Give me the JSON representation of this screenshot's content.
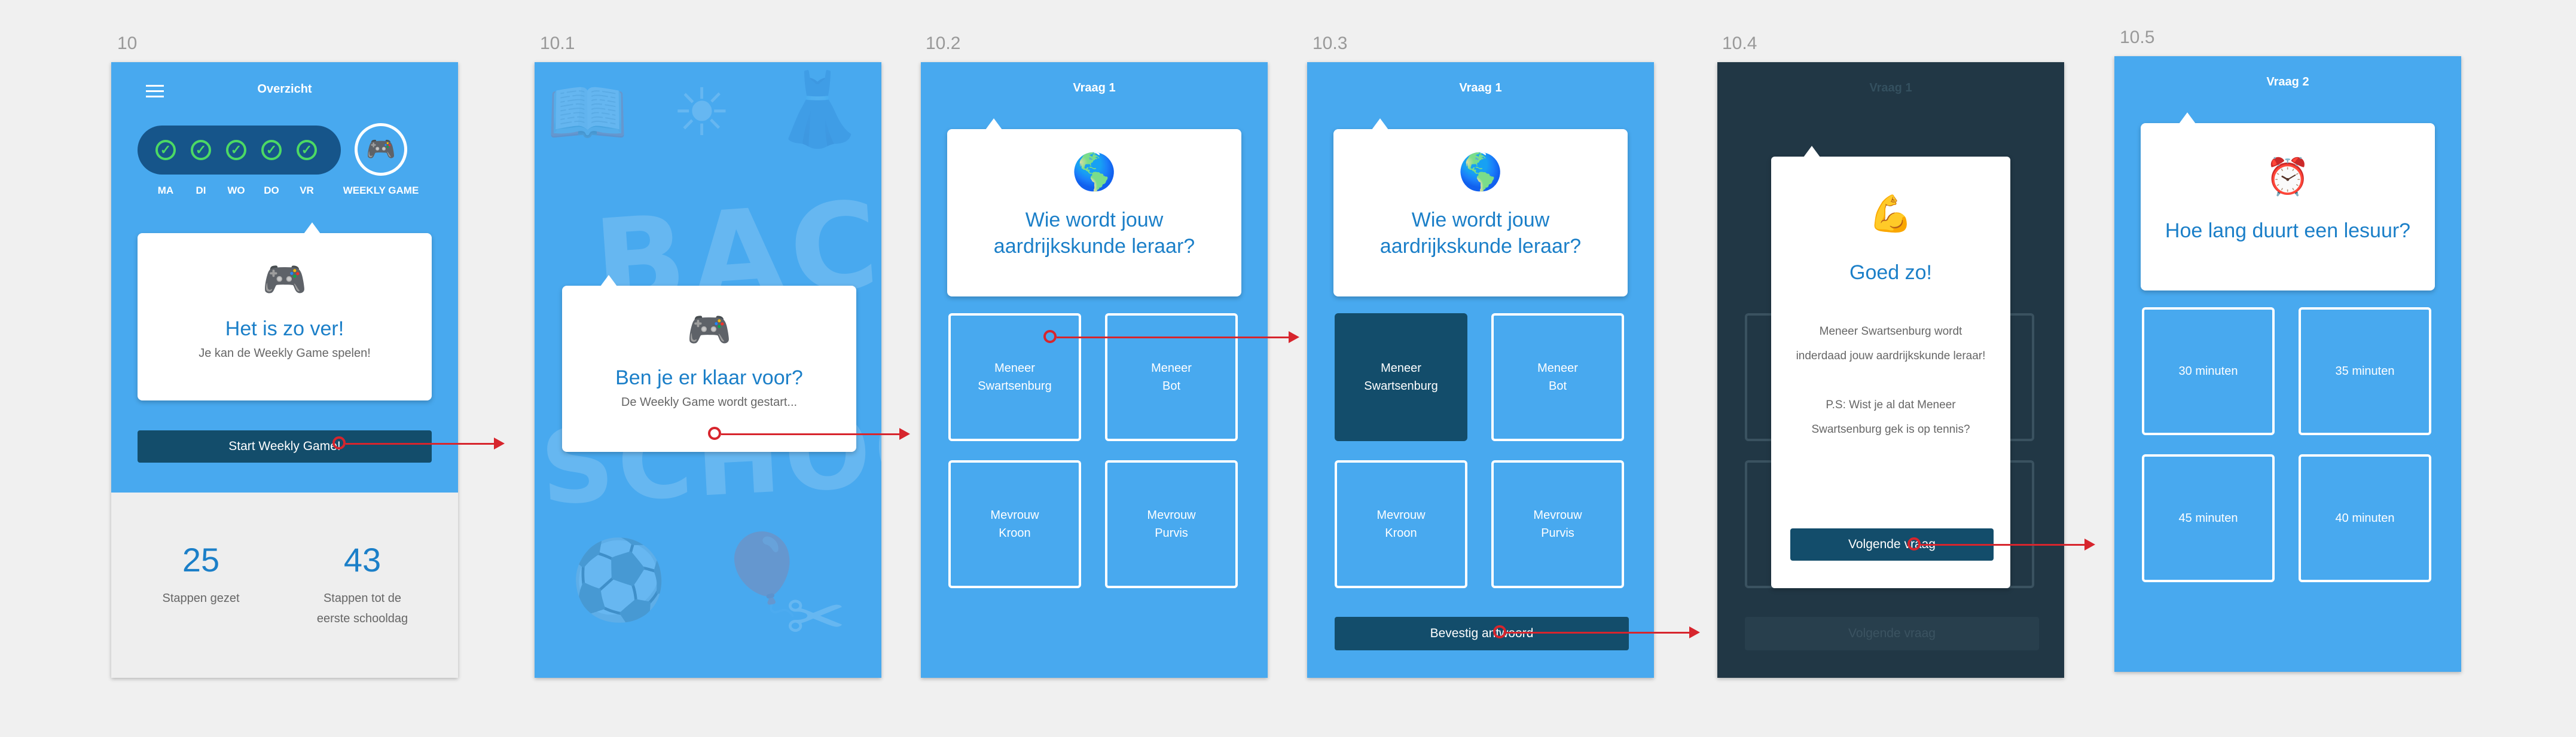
{
  "labels": [
    "10",
    "10.1",
    "10.2",
    "10.3",
    "10.4",
    "10.5"
  ],
  "s10": {
    "title": "Overzicht",
    "days": [
      "MA",
      "DI",
      "WO",
      "DO",
      "VR"
    ],
    "weekly_label": "WEEKLY GAME",
    "emoji": "🎮",
    "heading": "Het is zo ver!",
    "sub": "Je kan de Weekly Game spelen!",
    "button": "Start Weekly Game!",
    "stat1_num": "25",
    "stat1_label": "Stappen gezet",
    "stat2_num": "43",
    "stat2_label": "Stappen tot de\neerste schooldag"
  },
  "s101": {
    "bg_text1": "BACK",
    "bg_text2": "SCHOOL",
    "emoji": "🎮",
    "heading": "Ben je er klaar voor?",
    "sub": "De Weekly Game wordt gestart..."
  },
  "q1": {
    "title": "Vraag 1",
    "emoji": "🌎",
    "question": "Wie wordt jouw\naardrijkskunde leraar?",
    "answers": [
      "Meneer\nSwartsenburg",
      "Meneer\nBot",
      "Mevrouw\nKroon",
      "Mevrouw\nPurvis"
    ],
    "confirm": "Bevestig antwoord"
  },
  "s104": {
    "title": "Vraag 1",
    "emoji": "💪",
    "heading": "Goed zo!",
    "body": "Meneer Swartsenburg wordt inderdaad jouw aardrijkskunde leraar!\n\nP.S: Wist je al dat Meneer Swartsenburg gek is op tennis?",
    "button": "Volgende vraag",
    "ghost_button": "Volgende vraag"
  },
  "s105": {
    "title": "Vraag 2",
    "emoji": "⏰",
    "question": "Hoe lang duurt een lesuur?",
    "answers": [
      "30 minuten",
      "35 minuten",
      "45 minuten",
      "40 minuten"
    ]
  }
}
